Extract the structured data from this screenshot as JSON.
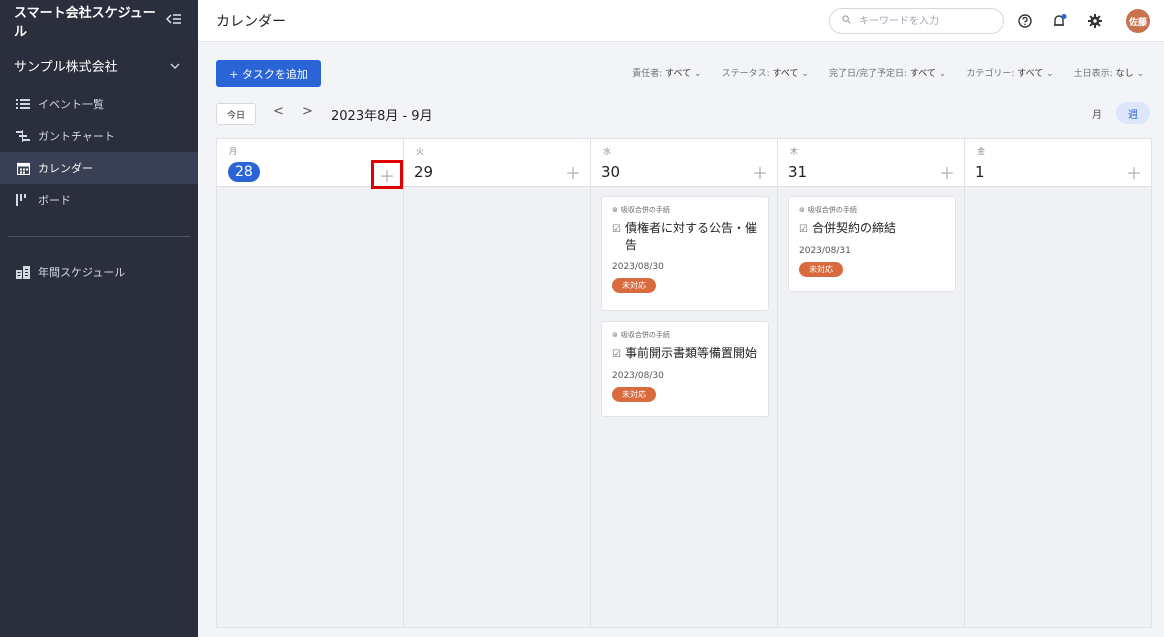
{
  "sidebar": {
    "app_title": "スマート会社スケジュール",
    "collapse_icon": "collapse-left-icon",
    "company": "サンプル株式会社",
    "nav": [
      {
        "label": "イベント一覧",
        "icon": "list-icon"
      },
      {
        "label": "ガントチャート",
        "icon": "gantt-icon"
      },
      {
        "label": "カレンダー",
        "icon": "calendar-icon",
        "active": true
      },
      {
        "label": "ボード",
        "icon": "board-icon"
      }
    ],
    "annual": {
      "label": "年間スケジュール",
      "icon": "annual-schedule-icon"
    }
  },
  "header": {
    "title": "カレンダー",
    "search_placeholder": "キーワードを入力",
    "avatar_text": "佐藤"
  },
  "toolbar": {
    "add_task": "+ タスクを追加",
    "filters": [
      {
        "label": "責任者:",
        "value": "すべて"
      },
      {
        "label": "ステータス:",
        "value": "すべて"
      },
      {
        "label": "完了日/完了予定日:",
        "value": "すべて"
      },
      {
        "label": "カテゴリー:",
        "value": "すべて"
      },
      {
        "label": "土日表示:",
        "value": "なし"
      }
    ],
    "today": "今日",
    "prev": "<",
    "next": ">",
    "range": "2023年8月 - 9月",
    "view_month": "月",
    "view_week": "週"
  },
  "calendar": {
    "days": [
      {
        "dow": "月",
        "day": "28",
        "is_today": true
      },
      {
        "dow": "火",
        "day": "29"
      },
      {
        "dow": "水",
        "day": "30"
      },
      {
        "dow": "木",
        "day": "31"
      },
      {
        "dow": "金",
        "day": "1"
      }
    ],
    "cards": {
      "wed": [
        {
          "category": "吸収合併の手続",
          "title": "債権者に対する公告・催告",
          "date": "2023/08/30",
          "status": "未対応"
        },
        {
          "category": "吸収合併の手続",
          "title": "事前開示書類等備置開始",
          "date": "2023/08/30",
          "status": "未対応"
        }
      ],
      "thu": [
        {
          "category": "吸収合併の手続",
          "title": "合併契約の締結",
          "date": "2023/08/31",
          "status": "未対応"
        }
      ]
    }
  },
  "colors": {
    "accent": "#2a64d6",
    "badge": "#d96a3e",
    "sidebar_bg": "#2b2f3d",
    "highlight": "#e00000"
  }
}
